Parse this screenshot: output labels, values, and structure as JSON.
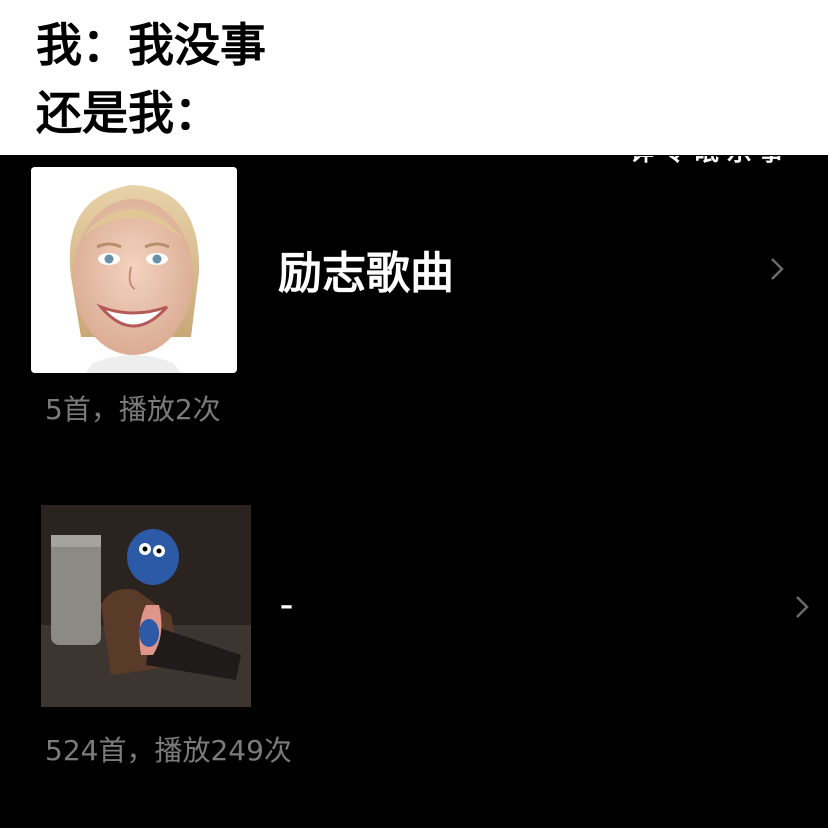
{
  "caption": {
    "line1": "我：我没事",
    "line2": "还是我："
  },
  "cut_off_text": "详 令 眠 乐 事",
  "playlists": [
    {
      "cover_icon": "smiling-woman-photo",
      "title": "励志歌曲",
      "meta": "5首，播放2次"
    },
    {
      "cover_icon": "slumped-cookie-monster-photo",
      "title": "–",
      "meta": "524首，播放249次"
    }
  ],
  "colors": {
    "caption_bg": "#ffffff",
    "screen_bg": "#000000",
    "title": "#ffffff",
    "meta": "#7b7b7b",
    "chevron": "#6b6b6b"
  }
}
